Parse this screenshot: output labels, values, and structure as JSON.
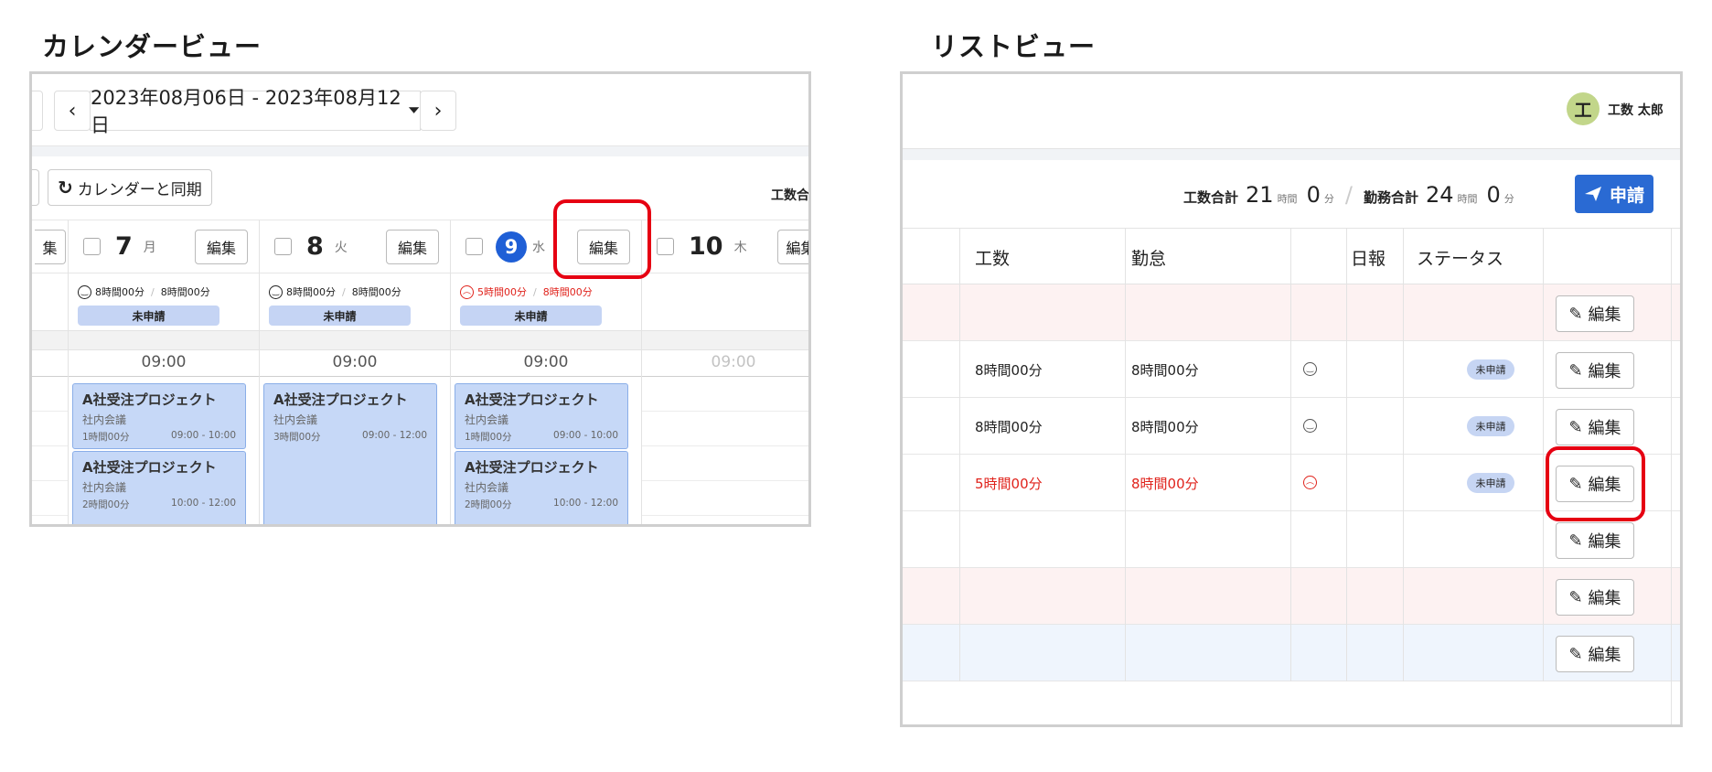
{
  "headings": {
    "calendar_view": "カレンダービュー",
    "list_view": "リストビュー"
  },
  "calendar": {
    "prev_icon": "‹",
    "next_icon": "›",
    "date_range": "2023年08月06日 - 2023年08月12日",
    "sync_label": "カレンダーと同期",
    "total_label_cut": "工数合",
    "partial_edit": "集",
    "days": [
      {
        "num": "7",
        "dow": "月",
        "edit": "編集",
        "work": "8時間00分",
        "attend": "8時間00分",
        "status": "未申請",
        "mood": "happy",
        "time": "09:00"
      },
      {
        "num": "8",
        "dow": "火",
        "edit": "編集",
        "work": "8時間00分",
        "attend": "8時間00分",
        "status": "未申請",
        "mood": "happy",
        "time": "09:00"
      },
      {
        "num": "9",
        "dow": "水",
        "edit": "編集",
        "work": "5時間00分",
        "attend": "8時間00分",
        "status": "未申請",
        "mood": "sad",
        "time": "09:00"
      },
      {
        "num": "10",
        "dow": "木",
        "edit": "編集",
        "time": "09:00"
      }
    ],
    "events": [
      {
        "title": "A社受注プロジェクト",
        "sub": "社内会議",
        "dur": "1時間00分",
        "range": "09:00 - 10:00"
      },
      {
        "title": "A社受注プロジェクト",
        "sub": "社内会議",
        "dur": "2時間00分",
        "range": "10:00 - 12:00"
      },
      {
        "title": "A社受注プロジェクト",
        "sub": "社内会議",
        "dur": "3時間00分",
        "range": "09:00 - 12:00"
      },
      {
        "title": "A社受注プロジェクト",
        "sub": "社内会議",
        "dur": "1時間00分",
        "range": "09:00 - 10:00"
      },
      {
        "title": "A社受注プロジェクト",
        "sub": "社内会議",
        "dur": "2時間00分",
        "range": "10:00 - 12:00"
      }
    ]
  },
  "list": {
    "avatar_initial": "工",
    "user_name": "工数 太郎",
    "summary": {
      "work_label": "工数合計",
      "work_hours": "21",
      "work_minutes": "0",
      "attend_label": "勤務合計",
      "attend_hours": "24",
      "attend_minutes": "0",
      "hours_unit": "時間",
      "minutes_unit": "分",
      "sep": "/"
    },
    "apply_label": "申請",
    "columns": {
      "work": "工数",
      "attendance": "勤怠",
      "report": "日報",
      "status": "ステータス"
    },
    "edit_label": "編集",
    "rows": [
      {
        "work": "",
        "attend": "",
        "mood": "",
        "status": ""
      },
      {
        "work": "8時間00分",
        "attend": "8時間00分",
        "mood": "happy",
        "status": "未申請"
      },
      {
        "work": "8時間00分",
        "attend": "8時間00分",
        "mood": "happy",
        "status": "未申請"
      },
      {
        "work": "5時間00分",
        "attend": "8時間00分",
        "mood": "sad",
        "status": "未申請"
      },
      {
        "work": "",
        "attend": "",
        "mood": "",
        "status": ""
      },
      {
        "work": "",
        "attend": "",
        "mood": "",
        "status": ""
      },
      {
        "work": "",
        "attend": "",
        "mood": "",
        "status": ""
      }
    ]
  },
  "colors": {
    "accent": "#2a6ad3",
    "highlight": "#e60012",
    "alert": "#e0231c",
    "event": "#c6d8f7"
  }
}
